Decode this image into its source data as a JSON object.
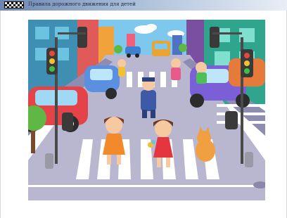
{
  "window": {
    "title": "Правила дорожного движения для детей",
    "icon": "checkered-flag-icon"
  },
  "illustration": {
    "scene": "street-crossing-illustration",
    "colors": {
      "sky": "#7ec8ee",
      "road": "#b9b6cf",
      "sidewalk": "#8e8cb0",
      "crosswalk": "#ffffff",
      "grass": "#5fb845"
    }
  }
}
